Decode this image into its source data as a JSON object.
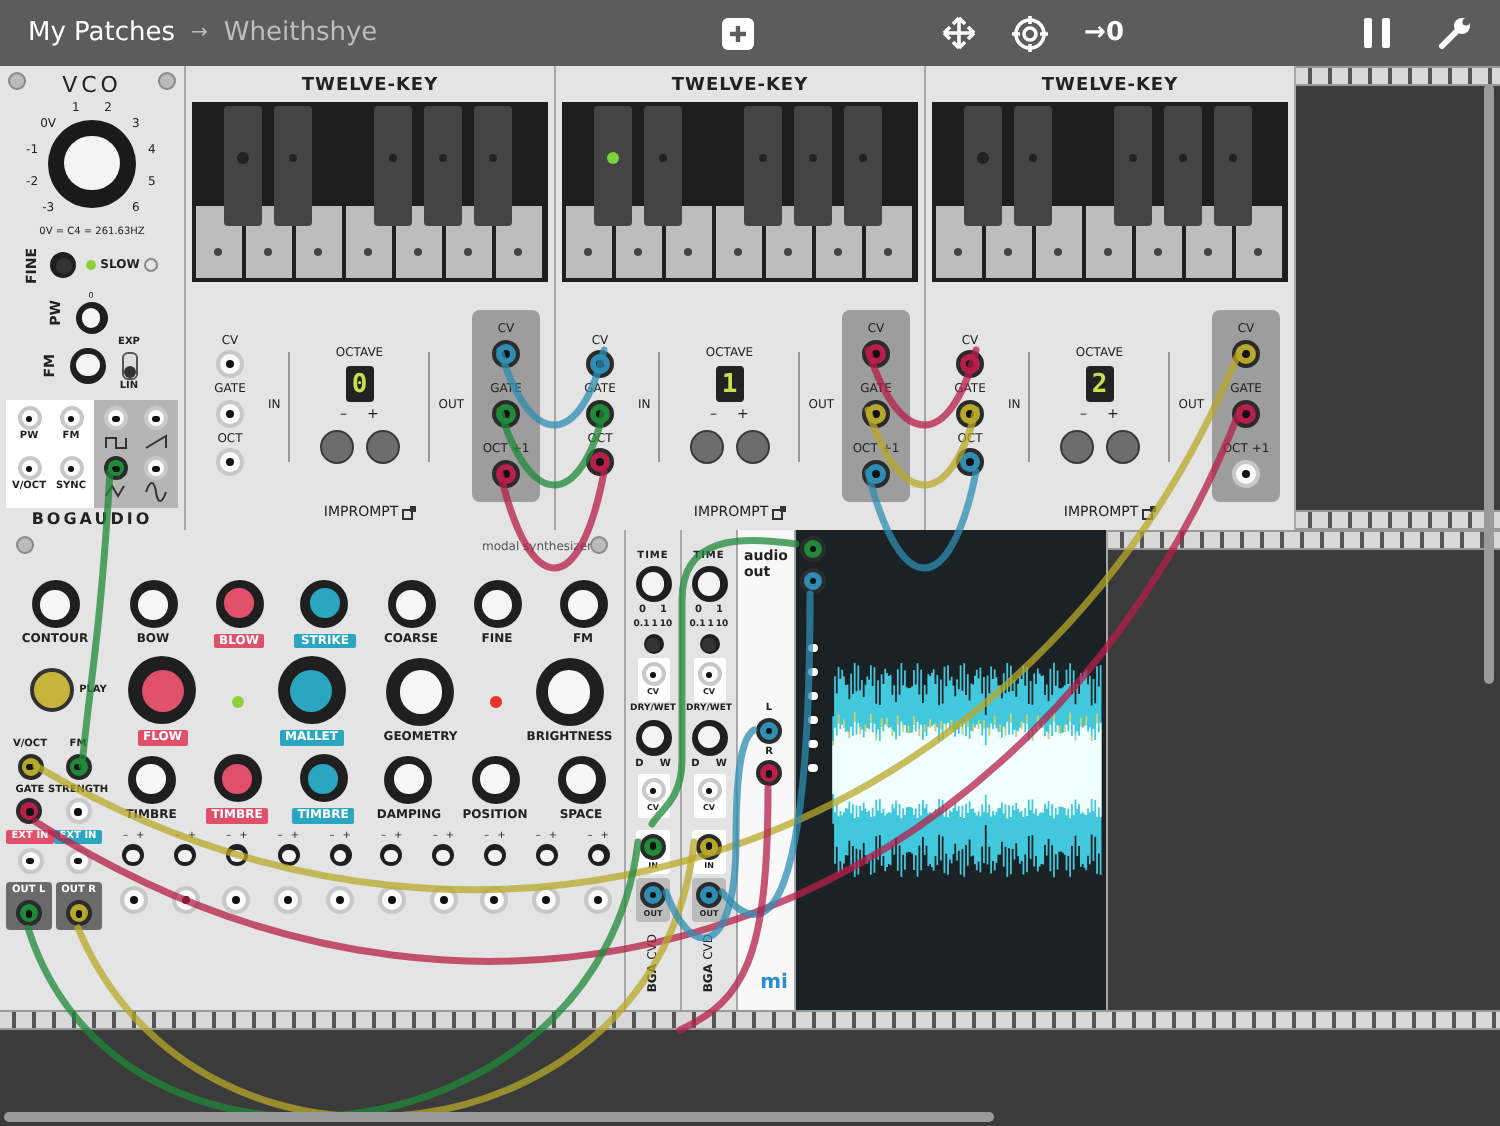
{
  "toolbar": {
    "breadcrumb": [
      {
        "label": "My Patches",
        "selected": false
      },
      {
        "label": "Wheithshye",
        "selected": true
      }
    ],
    "separator": "→",
    "reset_label": "→0"
  },
  "vco": {
    "title": "VCO",
    "dial_labels": [
      "-3",
      "-2",
      "-1",
      "0V",
      "1",
      "2",
      "3",
      "4",
      "5",
      "6"
    ],
    "tuning": "0V = C4 = 261.63HZ",
    "fine": "FINE",
    "slow": "SLOW",
    "slow_on": true,
    "pw": "PW",
    "pw_tick": "0",
    "fm": "FM",
    "exp": "EXP",
    "lin": "LIN",
    "exp_on": false,
    "inputs": [
      {
        "label": "PW"
      },
      {
        "label": "FM"
      },
      {
        "label": "V/OCT"
      },
      {
        "label": "SYNC"
      }
    ],
    "outputs": [
      {
        "kind": "square"
      },
      {
        "kind": "saw"
      },
      {
        "kind": "triangle",
        "color": "#1f8a3a"
      },
      {
        "kind": "sine"
      }
    ],
    "brand": "BOGAUDIO"
  },
  "twelve_keys": [
    {
      "title": "TWELVE-KEY",
      "led_on": false,
      "inputs": [
        {
          "label": "CV"
        },
        {
          "label": "GATE"
        },
        {
          "label": "OCT"
        }
      ],
      "octave_label": "OCTAVE",
      "octave": "0",
      "in": "IN",
      "out": "OUT",
      "minus": "–",
      "plus": "+",
      "outputs": [
        {
          "label": "CV",
          "color": "#2f8db3"
        },
        {
          "label": "GATE",
          "color": "#1f8a3a"
        },
        {
          "label": "OCT +1",
          "color": "#b51f4a"
        }
      ],
      "brand": "IMPROMPT"
    },
    {
      "title": "TWELVE-KEY",
      "led_on": true,
      "inputs": [
        {
          "label": "CV",
          "color": "#2f8db3"
        },
        {
          "label": "GATE",
          "color": "#1f8a3a"
        },
        {
          "label": "OCT",
          "color": "#b51f4a"
        }
      ],
      "octave_label": "OCTAVE",
      "octave": "1",
      "in": "IN",
      "out": "OUT",
      "minus": "–",
      "plus": "+",
      "outputs": [
        {
          "label": "CV",
          "color": "#b51f4a"
        },
        {
          "label": "GATE",
          "color": "#b8a82a"
        },
        {
          "label": "OCT +1",
          "color": "#2f8db3"
        }
      ],
      "brand": "IMPROMPT"
    },
    {
      "title": "TWELVE-KEY",
      "led_on": false,
      "inputs": [
        {
          "label": "CV",
          "color": "#b51f4a"
        },
        {
          "label": "GATE",
          "color": "#b8a82a"
        },
        {
          "label": "OCT",
          "color": "#2f8db3"
        }
      ],
      "octave_label": "OCTAVE",
      "octave": "2",
      "in": "IN",
      "out": "OUT",
      "minus": "–",
      "plus": "+",
      "outputs": [
        {
          "label": "CV",
          "color": "#b8a82a"
        },
        {
          "label": "GATE",
          "color": "#b51f4a"
        },
        {
          "label": "OCT +1"
        }
      ],
      "brand": "IMPROMPT"
    }
  ],
  "modal": {
    "title": "modal synthesizer",
    "top_knobs": [
      {
        "label": "CONTOUR"
      },
      {
        "label": "BOW"
      },
      {
        "label": "BLOW",
        "color": "#e0506a"
      },
      {
        "label": "STRIKE",
        "color": "#2aa6c0"
      },
      {
        "label": "COARSE"
      },
      {
        "label": "FINE"
      },
      {
        "label": "FM"
      }
    ],
    "play": "PLAY",
    "big_knobs": [
      {
        "label": "FLOW",
        "color": "#e0506a"
      },
      {
        "label": "MALLET",
        "color": "#2aa6c0"
      },
      {
        "label": "GEOMETRY"
      },
      {
        "label": "BRIGHTNESS"
      }
    ],
    "leds": [
      {
        "color": "#8fd13a"
      },
      {
        "color": "#e5352b"
      }
    ],
    "jacks": [
      {
        "label": "V/OCT",
        "color": "#b8a82a"
      },
      {
        "label": "FM",
        "color": "#1f8a3a"
      },
      {
        "label": "GATE",
        "color": "#b51f4a"
      },
      {
        "label": "STRENGTH"
      }
    ],
    "ext_inputs": [
      {
        "label": "EXT IN",
        "color": "#e0506a"
      },
      {
        "label": "EXT IN",
        "color": "#2aa6c0"
      }
    ],
    "outputs": [
      {
        "label": "OUT L",
        "color": "#1f8a3a"
      },
      {
        "label": "OUT R",
        "color": "#b8a82a"
      }
    ],
    "timbre_knobs": [
      {
        "label": "TIMBRE"
      },
      {
        "label": "TIMBRE",
        "color": "#e0506a"
      },
      {
        "label": "TIMBRE",
        "color": "#2aa6c0"
      },
      {
        "label": "DAMPING"
      },
      {
        "label": "POSITION"
      },
      {
        "label": "SPACE"
      }
    ],
    "attenuverters": [
      {
        "minus": "–",
        "plus": "+"
      },
      {
        "minus": "–",
        "plus": "+"
      },
      {
        "minus": "–",
        "plus": "+"
      },
      {
        "minus": "–",
        "plus": "+"
      },
      {
        "minus": "–",
        "plus": "+"
      },
      {
        "minus": "–",
        "plus": "+"
      },
      {
        "minus": "–",
        "plus": "+"
      },
      {
        "minus": "–",
        "plus": "+"
      },
      {
        "minus": "–",
        "plus": "+"
      },
      {
        "minus": "–",
        "plus": "+"
      }
    ]
  },
  "delays": [
    {
      "time": "TIME",
      "time_scale": [
        "0",
        "1"
      ],
      "range": [
        "0.1",
        "1",
        "10"
      ],
      "cv": "CV",
      "mix": "DRY/WET",
      "mix_scale": [
        "D",
        "W"
      ],
      "cv2": "CV",
      "in": {
        "label": "IN",
        "color": "#1f8a3a"
      },
      "out": {
        "label": "OUT",
        "color": "#2f8db3"
      },
      "name": "CVD",
      "brand": "BGA"
    },
    {
      "time": "TIME",
      "time_scale": [
        "0",
        "1"
      ],
      "range": [
        "0.1",
        "1",
        "10"
      ],
      "cv": "CV",
      "mix": "DRY/WET",
      "mix_scale": [
        "D",
        "W"
      ],
      "cv2": "CV",
      "in": {
        "label": "IN",
        "color": "#b8a82a"
      },
      "out": {
        "label": "OUT",
        "color": "#2f8db3"
      },
      "name": "CVD",
      "brand": "BGA"
    }
  ],
  "audio": {
    "title": "audio",
    "subtitle": "out",
    "inputs": [
      {
        "label": "L",
        "color": "#2f8db3"
      },
      {
        "label": "R",
        "color": "#b51f4a"
      }
    ],
    "brand": "mi"
  },
  "scope": {
    "inputs": [
      {
        "color": "#1f8a3a"
      },
      {
        "color": "#2f8db3"
      }
    ]
  }
}
